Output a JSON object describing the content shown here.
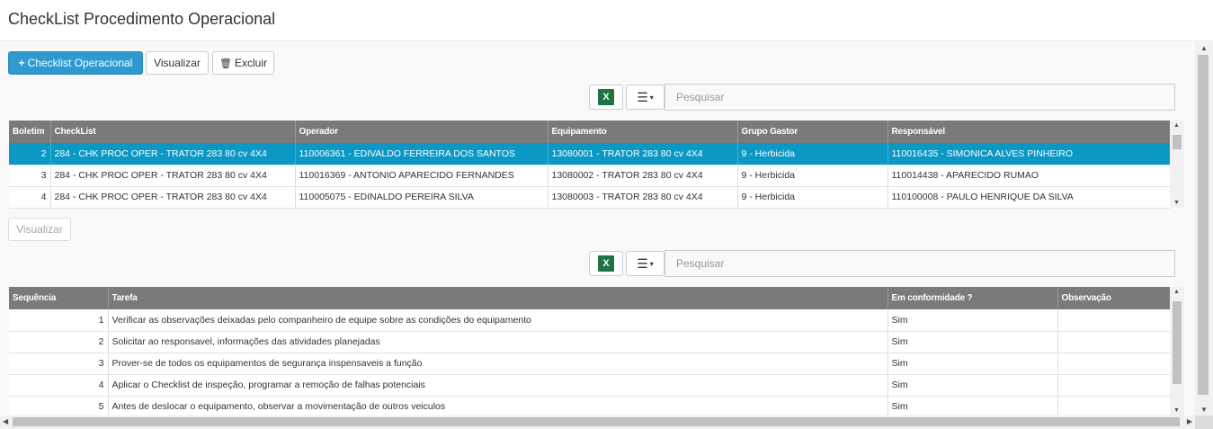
{
  "page": {
    "title": "CheckList Procedimento Operacional"
  },
  "toolbar": {
    "add_label": "Checklist Operacional",
    "view_label": "Visualizar",
    "delete_label": "Excluir"
  },
  "grid1": {
    "search_placeholder": "Pesquisar",
    "columns": [
      "Boletim",
      "CheckList",
      "Operador",
      "Equipamento",
      "Grupo Gastor",
      "Responsável"
    ],
    "rows": [
      [
        "2",
        "284 - CHK PROC OPER - TRATOR 283 80 cv 4X4",
        "110006361 - EDIVALDO FERREIRA DOS SANTOS",
        "13080001 - TRATOR 283 80 cv 4X4",
        "9 - Herbicida",
        "110016435 - SIMONICA ALVES PINHEIRO"
      ],
      [
        "3",
        "284 - CHK PROC OPER - TRATOR 283 80 cv 4X4",
        "110016369 - ANTONIO APARECIDO FERNANDES",
        "13080002 - TRATOR 283 80 cv 4X4",
        "9 - Herbicida",
        "110014438 - APARECIDO RUMAO"
      ],
      [
        "4",
        "284 - CHK PROC OPER - TRATOR 283 80 cv 4X4",
        "110005075 - EDINALDO PEREIRA SILVA",
        "13080003 - TRATOR 283 80 cv 4X4",
        "9 - Herbicida",
        "110100008 - PAULO HENRIQUE DA SILVA"
      ]
    ],
    "selected_row": 0
  },
  "detail": {
    "view_label": "Visualizar"
  },
  "grid2": {
    "search_placeholder": "Pesquisar",
    "columns": [
      "Sequência",
      "Tarefa",
      "Em conformidade ?",
      "Observação"
    ],
    "rows": [
      [
        "1",
        "Verificar as observações deixadas pelo companheiro de equipe sobre as condições do equipamento",
        "Sim",
        ""
      ],
      [
        "2",
        "Solicitar ao responsavel, informações das atividades planejadas",
        "Sim",
        ""
      ],
      [
        "3",
        "Prover-se de todos os equipamentos de segurança inspensaveis a função",
        "Sim",
        ""
      ],
      [
        "4",
        "Aplicar o Checklist de inspeção, programar a remoção de falhas potenciais",
        "Sim",
        ""
      ],
      [
        "5",
        "Antes de deslocar o equipamento, observar a movimentação de outros veiculos",
        "Sim",
        ""
      ]
    ]
  },
  "icons": {
    "plus": "+",
    "trash": "🗑",
    "excel": "X",
    "list": "☰",
    "caret": "▾",
    "up": "▲",
    "down": "▼",
    "left": "◀",
    "right": "▶"
  },
  "colors": {
    "accent": "#2e9ad0",
    "selected_row": "#0c98c4",
    "header_bg": "#7a7a7a",
    "excel": "#1f7244"
  }
}
